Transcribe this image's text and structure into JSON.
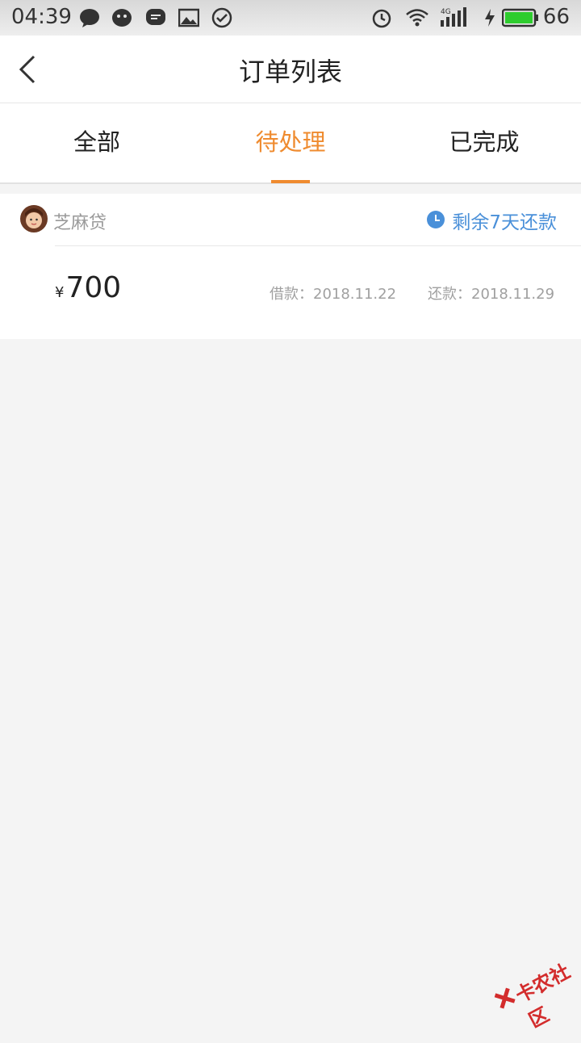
{
  "statusbar": {
    "time": "04:39",
    "battery": "66",
    "left_icons": [
      "message-icon",
      "wechat-icon",
      "chat-icon",
      "image-icon",
      "check-icon"
    ],
    "right_icons": [
      "alarm-icon",
      "wifi-icon",
      "4g-signal-icon",
      "charging-icon",
      "battery-icon"
    ],
    "network_label": "4G"
  },
  "header": {
    "title": "订单列表",
    "back_icon": "back-arrow-icon"
  },
  "tabs": [
    {
      "label": "全部",
      "active": false
    },
    {
      "label": "待处理",
      "active": true
    },
    {
      "label": "已完成",
      "active": false
    }
  ],
  "order": {
    "lender": "芝麻贷",
    "remaining": "剩余7天还款",
    "currency": "¥",
    "amount": "700",
    "borrow_date": "借款：2018.11.22",
    "repay_date": "还款：2018.11.29"
  },
  "watermark": {
    "text": "卡农社区"
  },
  "colors": {
    "accent": "#ef8b2f",
    "blue": "#4a90d9",
    "background": "#f4f4f4"
  }
}
